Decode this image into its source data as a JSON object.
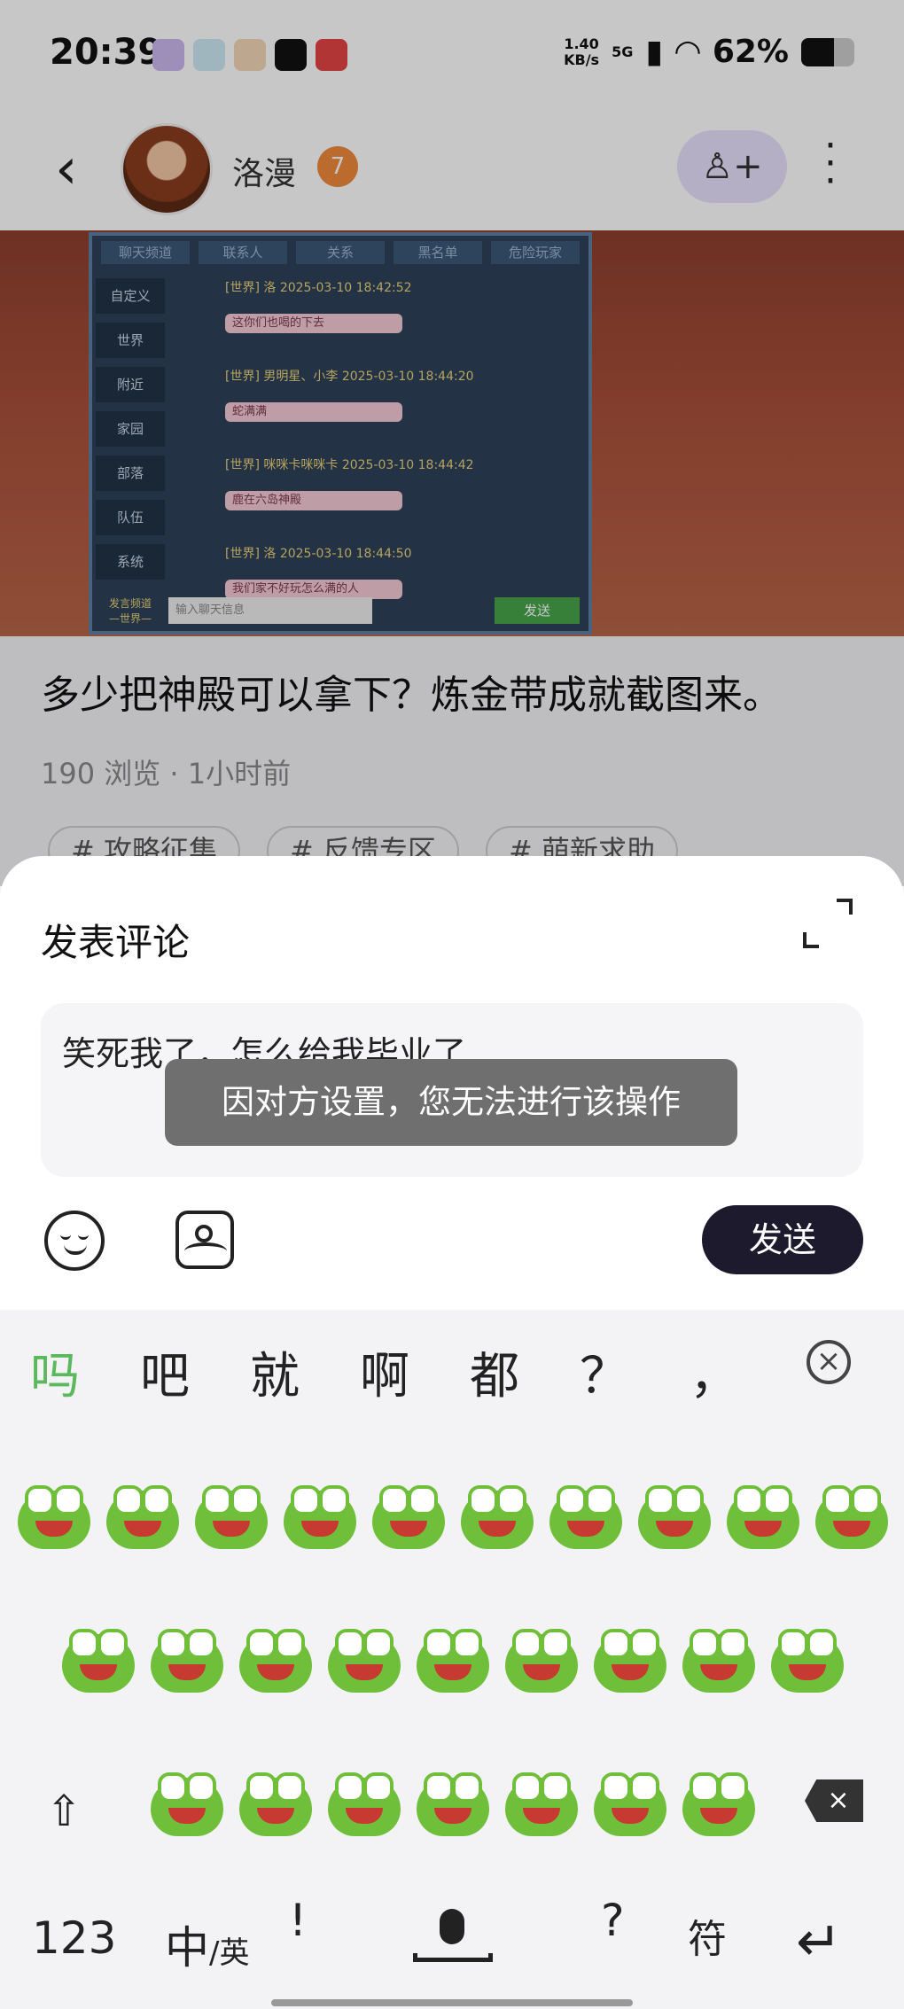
{
  "status_bar": {
    "time": "20:39",
    "net_speed": "1.40\nKB/s",
    "network": "5G",
    "battery": "62%",
    "battery_level": 0.62
  },
  "header": {
    "back_icon": "chevron-left-icon",
    "username": "洛漫",
    "level": "7",
    "follow_icon": "add-user-icon",
    "more_icon": "more-vertical-icon"
  },
  "game_screenshot": {
    "tabs": [
      "聊天频道",
      "联系人",
      "关系",
      "黑名单",
      "危险玩家"
    ],
    "side_tabs": [
      "自定义",
      "世界",
      "附近",
      "家园",
      "部落",
      "队伍",
      "系统"
    ],
    "messages": [
      {
        "meta": "[世界] 洛  2025-03-10  18:42:52",
        "text": "这你们也喝的下去"
      },
      {
        "meta": "[世界] 男明星、小李  2025-03-10  18:44:20",
        "text": "蛇满满"
      },
      {
        "meta": "[世界] 咪咪卡咪咪卡  2025-03-10  18:44:42",
        "text": "鹿在六岛神殿"
      },
      {
        "meta": "[世界] 洛  2025-03-10  18:44:50",
        "text": "我们家不好玩怎么满的人"
      }
    ],
    "channel_label": "发言频道\n—世界—",
    "input_placeholder": "输入聊天信息",
    "send": "发送"
  },
  "post": {
    "title": "多少把神殿可以拿下？炼金带成就截图来。",
    "meta": "190 浏览 · 1小时前",
    "tags": [
      "# 攻略征集",
      "# 反馈专区",
      "# 萌新求助"
    ]
  },
  "comment_sheet": {
    "title": "发表评论",
    "expand_icon": "expand-icon",
    "input_value": "笑死我了，怎么给我毕业了",
    "toast": "因对方设置，您无法进行该操作",
    "emoji_icon": "emoji-icon",
    "image_icon": "image-icon",
    "send_label": "发送"
  },
  "keyboard": {
    "candidates": [
      "吗",
      "吧",
      "就",
      "啊",
      "都",
      "？",
      "，"
    ],
    "close_icon": "close-circle-icon",
    "emoji_rows": [
      10,
      9,
      7
    ],
    "emoji_name": "frog-icon",
    "shift_icon": "shift-icon",
    "backspace_icon": "backspace-icon",
    "bottom_keys": {
      "numbers": "123",
      "lang_main": "中",
      "lang_sub": "/英",
      "exclaim": "!",
      "mic_icon": "mic-icon",
      "question": "?",
      "symbols": "符",
      "enter_icon": "enter-icon"
    }
  }
}
